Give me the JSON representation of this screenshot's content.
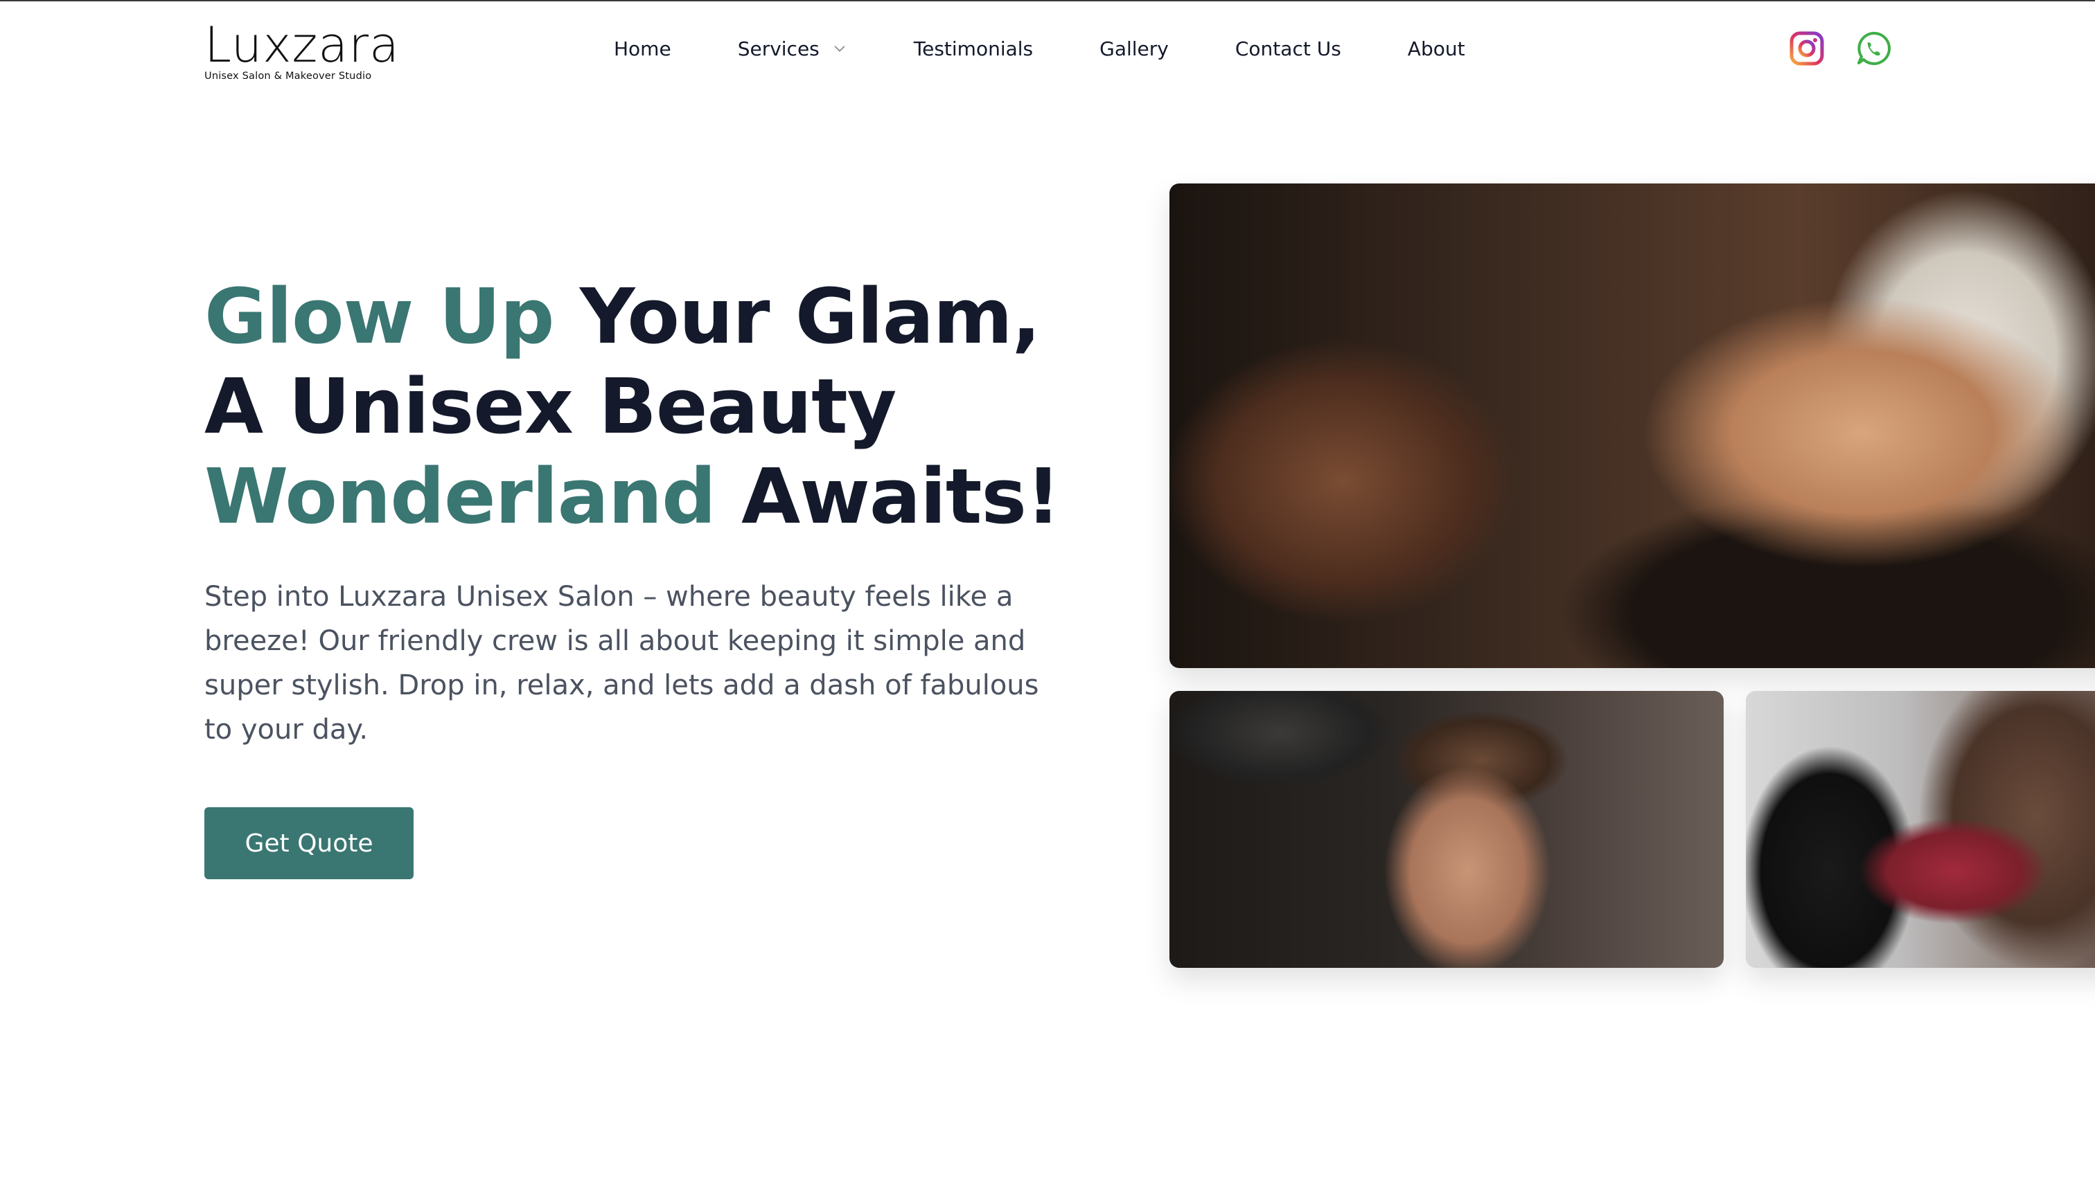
{
  "brand": {
    "name": "Luxzara",
    "tagline": "Unisex Salon & Makeover Studio"
  },
  "nav": {
    "items": [
      {
        "label": "Home"
      },
      {
        "label": "Services",
        "has_dropdown": true
      },
      {
        "label": "Testimonials"
      },
      {
        "label": "Gallery"
      },
      {
        "label": "Contact Us"
      },
      {
        "label": "About"
      }
    ]
  },
  "social": {
    "instagram_icon": "instagram-icon",
    "whatsapp_icon": "whatsapp-icon"
  },
  "hero": {
    "headline": {
      "line1_accent": "Glow Up",
      "line1_rest": " Your Glam,",
      "line2": "A Unisex Beauty",
      "line3_accent": "Wonderland",
      "line3_rest": " Awaits!"
    },
    "description": "Step into Luxzara Unisex Salon – where beauty feels like a breeze! Our friendly crew is all about keeping it simple and super stylish. Drop in, relax, and lets add a dash of fabulous to your day.",
    "cta_label": "Get Quote"
  },
  "colors": {
    "accent": "#3a7672",
    "heading": "#141a2b",
    "body_text": "#4b5260"
  }
}
